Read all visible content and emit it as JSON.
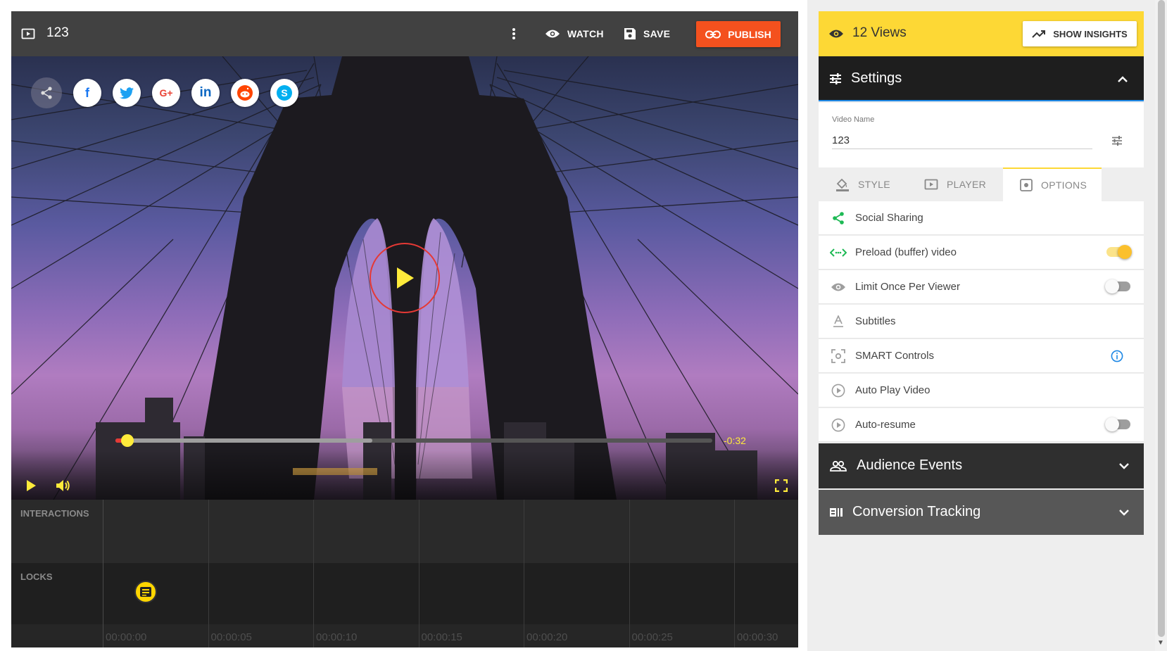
{
  "editor": {
    "title": "123",
    "actions": {
      "watch": "WATCH",
      "save": "SAVE",
      "publish": "PUBLISH"
    }
  },
  "player": {
    "share_icons": [
      "share-icon",
      "facebook-icon",
      "twitter-icon",
      "google-plus-icon",
      "linkedin-icon",
      "reddit-icon",
      "skype-icon"
    ],
    "share_glyphs": {
      "facebook": "f",
      "google": "G+",
      "linkedin": "in",
      "skype": "S"
    },
    "time_remaining": "-0:32",
    "progress": {
      "played_fraction": 0.02,
      "buffered_fraction": 0.43
    },
    "accent_color": "#ffeb3b"
  },
  "timeline": {
    "rows": {
      "interactions": "INTERACTIONS",
      "locks": "LOCKS"
    },
    "ticks": [
      "00:00:00",
      "00:00:05",
      "00:00:10",
      "00:00:15",
      "00:00:20",
      "00:00:25",
      "00:00:30"
    ]
  },
  "panel": {
    "views": "12 Views",
    "insights_button": "SHOW INSIGHTS",
    "settings": {
      "title": "Settings",
      "video_name_label": "Video Name",
      "video_name_value": "123"
    },
    "tabs": [
      {
        "label": "STYLE",
        "active": false
      },
      {
        "label": "PLAYER",
        "active": false
      },
      {
        "label": "OPTIONS",
        "active": true
      }
    ],
    "options": [
      {
        "label": "Social Sharing",
        "icon": "share-icon",
        "control": "none"
      },
      {
        "label": "Preload (buffer) video",
        "icon": "code-arrows-icon",
        "control": "toggle",
        "on": true
      },
      {
        "label": "Limit Once Per Viewer",
        "icon": "eye-icon",
        "control": "toggle",
        "on": false
      },
      {
        "label": "Subtitles",
        "icon": "text-format-icon",
        "control": "none"
      },
      {
        "label": "SMART Controls",
        "icon": "center-focus-icon",
        "control": "info"
      },
      {
        "label": "Auto Play Video",
        "icon": "play-circle-icon",
        "control": "none"
      },
      {
        "label": "Auto-resume",
        "icon": "play-circle-icon",
        "control": "toggle",
        "on": false
      }
    ],
    "audience_events": "Audience Events",
    "conversion_tracking": "Conversion Tracking"
  },
  "colors": {
    "publish": "#f4511e",
    "views_bar": "#fdd835",
    "settings_header": "#1e1e1e",
    "settings_underline": "#1e88e5",
    "social_green": "#1db954",
    "info_blue": "#1e88e5"
  }
}
